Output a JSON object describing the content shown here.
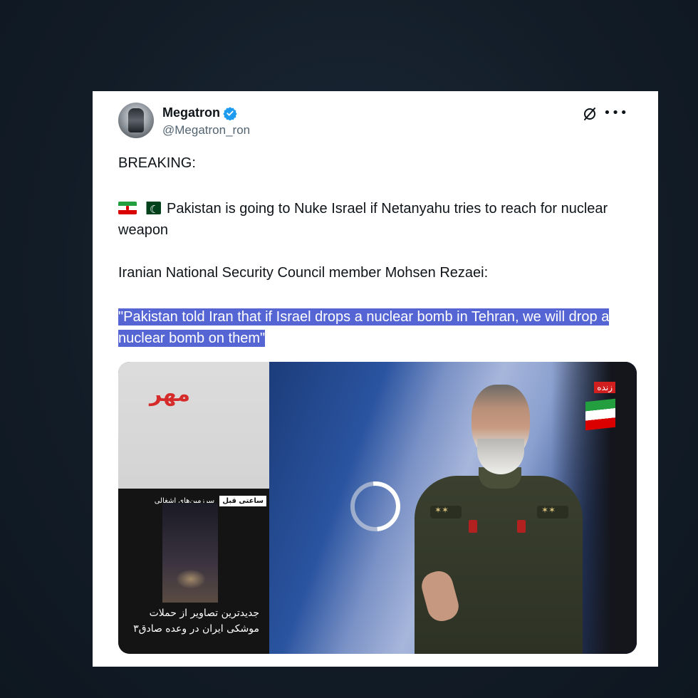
{
  "post": {
    "author": {
      "name": "Megatron",
      "handle": "@Megatron_ron",
      "verified": true
    },
    "body": {
      "headline": "BREAKING:",
      "line1": "Pakistan is going to Nuke Israel if Netanyahu tries to reach for nuclear weapon",
      "line2": "Iranian National Security Council member Mohsen Rezaei:",
      "quote": "\"Pakistan told Iran that if Israel drops a nuclear bomb in Tehran, we will drop a nuclear bomb on them\""
    },
    "flags": [
      "iran-flag-icon",
      "pakistan-flag-icon"
    ],
    "media": {
      "live_label": "زنده",
      "inset_caption_box": "ساعتی قبل",
      "inset_caption_text": "سرزمین‌های اشغالی",
      "bottom_caption": "جدیدترین تصاویر از حملات موشکی ایران در وعده صادق۳",
      "state": "loading"
    }
  },
  "colors": {
    "verified_blue": "#1d9bf0",
    "highlight": "#5566d4",
    "text": "#0f1419",
    "muted": "#536471"
  }
}
